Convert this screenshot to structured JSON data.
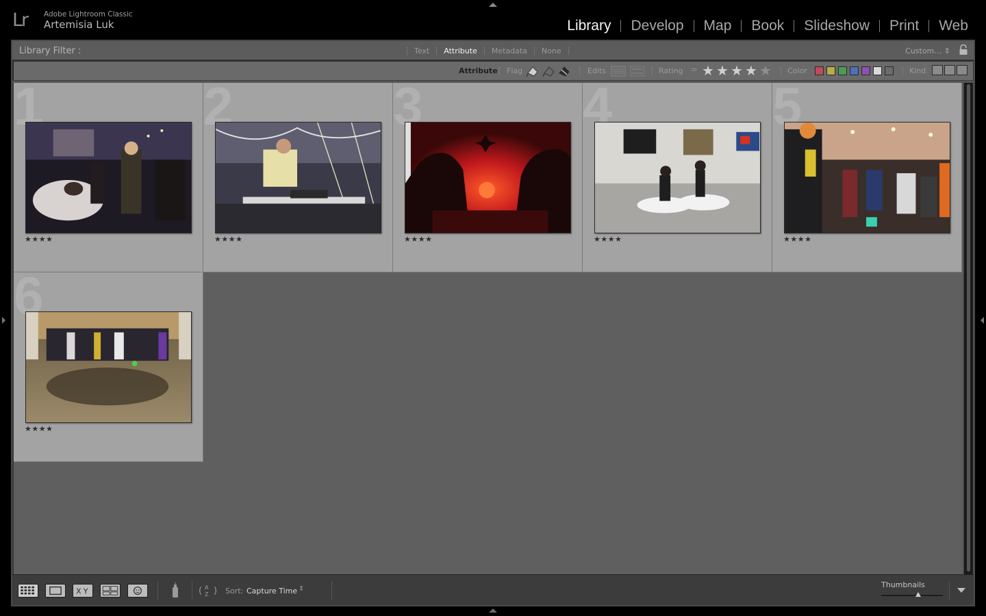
{
  "identity": {
    "logo": "Lr",
    "app_name": "Adobe Lightroom Classic",
    "user_name": "Artemisia Luk"
  },
  "modules": [
    {
      "label": "Library",
      "active": true
    },
    {
      "label": "Develop",
      "active": false
    },
    {
      "label": "Map",
      "active": false
    },
    {
      "label": "Book",
      "active": false
    },
    {
      "label": "Slideshow",
      "active": false
    },
    {
      "label": "Print",
      "active": false
    },
    {
      "label": "Web",
      "active": false
    }
  ],
  "filter_bar": {
    "title": "Library Filter :",
    "tabs": [
      {
        "label": "Text",
        "active": false
      },
      {
        "label": "Attribute",
        "active": true
      },
      {
        "label": "Metadata",
        "active": false
      },
      {
        "label": "None",
        "active": false
      }
    ],
    "preset": "Custom…"
  },
  "attribute_row": {
    "title": "Attribute",
    "flag_label": "Flag",
    "edits_label": "Edits",
    "rating_label": "Rating",
    "rating_operator": "=",
    "rating_value": 4,
    "color_label": "Color",
    "color_swatches": [
      "#c24a58",
      "#b7ad45",
      "#4f9a52",
      "#4f6fb8",
      "#8e4fb0",
      "#d9d9d9",
      "#6c6c6c"
    ],
    "kind_label": "Kind"
  },
  "grid": {
    "cells": [
      {
        "number": "1",
        "stars": "★★★★"
      },
      {
        "number": "2",
        "stars": "★★★★"
      },
      {
        "number": "3",
        "stars": "★★★★"
      },
      {
        "number": "4",
        "stars": "★★★★"
      },
      {
        "number": "5",
        "stars": "★★★★"
      },
      {
        "number": "6",
        "stars": "★★★★"
      }
    ]
  },
  "toolbar": {
    "sort_label": "Sort:",
    "sort_value": "Capture Time",
    "thumbnails_label": "Thumbnails",
    "thumbnail_size": 0.6
  }
}
